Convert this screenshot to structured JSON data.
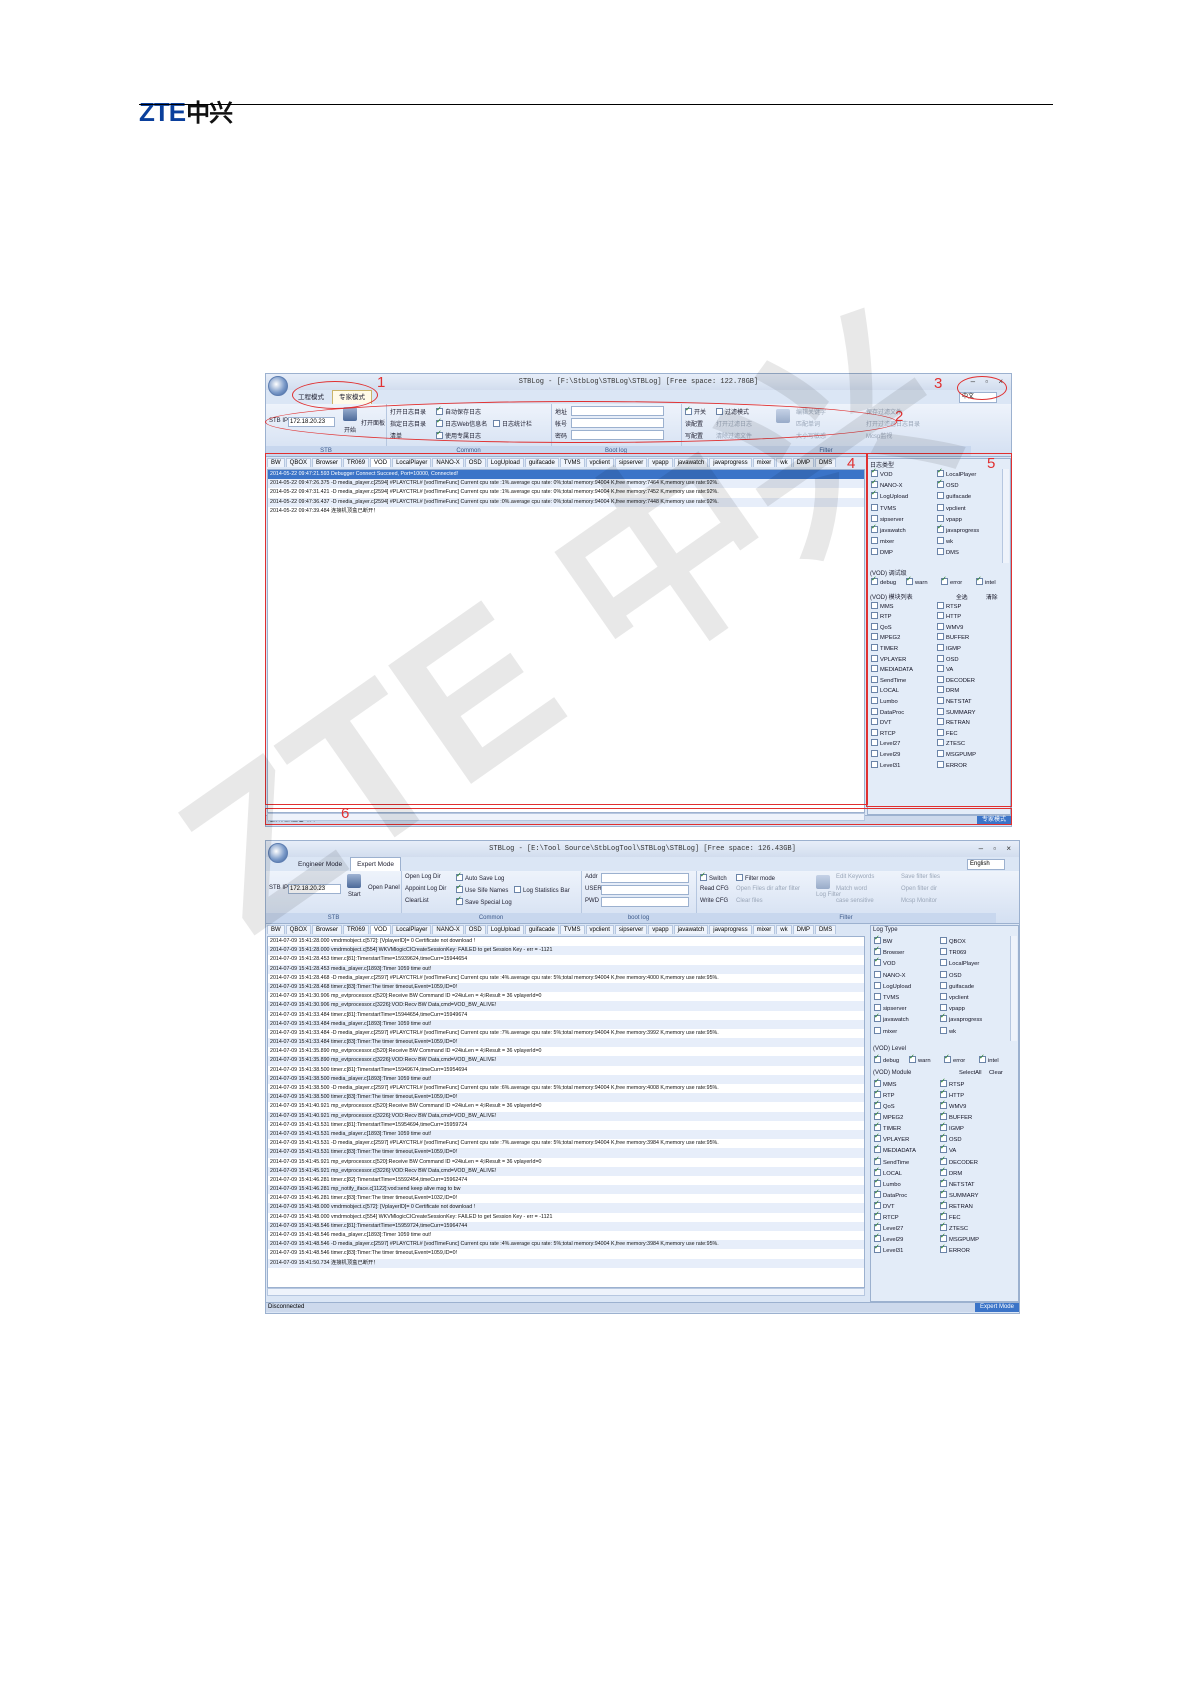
{
  "header": {
    "logo": "ZTE",
    "logo_cn": "中兴"
  },
  "watermark": "ZTE 中兴",
  "callouts": [
    "1",
    "2",
    "3",
    "4",
    "5",
    "6"
  ],
  "shot1": {
    "title": "STBLog - [F:\\StbLog\\STBLog\\STBLog] [Free space: 122.78GB]",
    "tabs": [
      "工程模式",
      "专家模式"
    ],
    "lang": "中文",
    "stb": {
      "label": "STB IP",
      "ip": "172.18.20.23",
      "start": "开始",
      "open_panel": "打开面板",
      "cap": "STB"
    },
    "common": {
      "items": [
        "打开日志目录",
        "指定日志目录",
        "清单",
        "自动保存日志",
        "日志Web信息名",
        "使用专属日志",
        "日志统计栏"
      ],
      "cap": "Common"
    },
    "bootlog": {
      "fields": [
        "地址",
        "帐号",
        "密码"
      ],
      "cap": "Boot log"
    },
    "filter": {
      "items": [
        "开关",
        "读配置",
        "写配置",
        "过滤模式",
        "打开过滤日志",
        "清除过滤文件",
        "编辑关键字",
        "匹配单词",
        "大小写敏感",
        "保存过滤文件",
        "打开过滤器日志目录",
        "Mcsp监视"
      ],
      "cap": "Filter"
    },
    "module_tabs": [
      "BW",
      "QBOX",
      "Browser",
      "TR069",
      "VOD",
      "LocalPlayer",
      "NANO-X",
      "OSD",
      "LogUpload",
      "guifacade",
      "TVMS",
      "vpclient",
      "sipserver",
      "vpapp",
      "javawatch",
      "javaprogress",
      "mixer",
      "wk",
      "DMP",
      "DMS"
    ],
    "logs": [
      "2014-05-22 09:47:21.593  Debugger Connect Succeed, Port=10000, Connected!",
      "2014-05-22 09:47:26.375  -D media_player.c[2594] #PLAYCTRL# [vodTimeFunc] Current cpu rate :1%.average cpu rate: 0%;total memory:94004 K,free memory:7464 K,memory use rate:92%.",
      "2014-05-22 09:47:31.421  -D media_player.c[2594] #PLAYCTRL# [vodTimeFunc] Current cpu rate :1%.average cpu rate: 0%;total memory:94004 K,free memory:7452 K,memory use rate:92%.",
      "2014-05-22 09:47:36.437  -D media_player.c[2594] #PLAYCTRL# [vodTimeFunc] Current cpu rate :0%.average cpu rate: 0%;total memory:94004 K,free memory:7448 K,memory use rate:92%.",
      "2014-05-22 09:47:39.484  连接机顶盒已断开！"
    ],
    "logtype_label": "日志类型",
    "logtypes": [
      "VOD",
      "LocalPlayer",
      "NANO-X",
      "OSD",
      "LogUpload",
      "guifacade",
      "TVMS",
      "vpclient",
      "sipserver",
      "vpapp",
      "javawatch",
      "javaprogress",
      "mixer",
      "wk",
      "DMP",
      "DMS"
    ],
    "logtypes_checked": [
      true,
      true,
      true,
      true,
      true,
      false,
      false,
      false,
      false,
      false,
      true,
      true,
      false,
      false,
      false,
      false
    ],
    "level_label": "(VOD) 调试级",
    "levels": [
      "debug",
      "warn",
      "error",
      "intel"
    ],
    "module_label": "(VOD) 模块列表",
    "select_all": "全选",
    "clear": "清除",
    "modules": [
      "MMS",
      "RTSP",
      "RTP",
      "HTTP",
      "QoS",
      "WMV9",
      "MPEG2",
      "BUFFER",
      "TIMER",
      "IGMP",
      "VPLAYER",
      "OSD",
      "MEDIADATA",
      "VA",
      "SendTime",
      "DECODER",
      "LOCAL",
      "DRM",
      "Lumbo",
      "NETSTAT",
      "DataProc",
      "SUMMARY",
      "DVT",
      "RETRAN",
      "RTCP",
      "FEC",
      "Level27",
      "ZTESC",
      "Level29",
      "MSGPUMP",
      "Level31",
      "ERROR"
    ],
    "status": "连接机顶盒已断开",
    "mode": "专家模式"
  },
  "shot2": {
    "title": "STBLog - [E:\\Tool Source\\StbLogTool\\STBLog\\STBLog] [Free space: 126.43GB]",
    "tabs": [
      "Engineer Mode",
      "Expert Mode"
    ],
    "lang": "English",
    "stb": {
      "label": "STB IP",
      "ip": "172.18.20.23",
      "start": "Start",
      "open_panel": "Open Panel",
      "cap": "STB"
    },
    "common": {
      "items": [
        "Open Log Dir",
        "Appoint Log Dir",
        "ClearList",
        "Auto Save Log",
        "Use Sife Names",
        "Save Special Log",
        "Log Statistics Bar"
      ],
      "cap": "Common"
    },
    "bootlog": {
      "fields": [
        "Addr",
        "USER",
        "PWD"
      ],
      "cap": "boot log"
    },
    "filter": {
      "items": [
        "Switch",
        "Read CFG",
        "Write CFG",
        "Filter mode",
        "Open Files dir after filter",
        "Clear files",
        "Log Filter",
        "Edit Keywords",
        "Match word",
        "case sensitive",
        "Save filter files",
        "Open filter dir",
        "Mcsp Monitor"
      ],
      "cap": "Filter"
    },
    "module_tabs": [
      "BW",
      "QBOX",
      "Browser",
      "TR069",
      "VOD",
      "LocalPlayer",
      "NANO-X",
      "OSD",
      "LogUpload",
      "guifacade",
      "TVMS",
      "vpclient",
      "sipserver",
      "vpapp",
      "javawatch",
      "javaprogress",
      "mixer",
      "wk",
      "DMP",
      "DMS"
    ],
    "logs": [
      "2014-07-09 15:41:28.000  vmdrmobject.c[572]: [VplayerID]= 0 Certificate not download !",
      "2014-07-09 15:41:28.000  vmdrmobject.c[554] WKVMlogicCICreateSessionKey: FAILED to get Session Key - err = -1121",
      "2014-07-09 15:41:28.453  timer.c[81]:TimerstartTime=15939624,timeCurr=15944654",
      "2014-07-09 15:41:28.453  media_player.c[1893]:Timer 1059  time out!",
      "2014-07-09 15:41:28.468  -D media_player.c[2597] #PLAYCTRL# [vodTimeFunc] Current cpu rate :4%.average cpu rate: 5%;total memory:94004 K,free memory:4000 K,memory use rate:95%.",
      "2014-07-09 15:41:28.468  timer.c[83]:Timer:The timer timeout,Event=1059,ID=0!",
      "2014-07-09 15:41:30.906  mp_evtprocessor.c[520]:Receive BW Command ID =24iuLen = 4;iResult = 36 vplayerId=0",
      "2014-07-09 15:41:30.906  mp_evtprocessor.c[3226]:VOD:Recv BW Data,cmd=VOD_BW_ALIVE!",
      "2014-07-09 15:41:33.484  timer.c[81]:TimerstartTime=15944654,timeCurr=15949674",
      "2014-07-09 15:41:33.484  media_player.c[1893]:Timer 1059  time out!",
      "2014-07-09 15:41:33.484  -D media_player.c[2597] #PLAYCTRL# [vodTimeFunc] Current cpu rate :7%.average cpu rate: 5%;total memory:94004 K,free memory:3992 K,memory use rate:95%.",
      "2014-07-09 15:41:33.484  timer.c[83]:Timer:The timer timeout,Event=1059,ID=0!",
      "2014-07-09 15:41:35.890  mp_evtprocessor.c[520]:Receive BW Command ID =24iuLen = 4;iResult = 36 vplayerId=0",
      "2014-07-09 15:41:35.890  mp_evtprocessor.c[3226]:VOD:Recv BW Data,cmd=VOD_BW_ALIVE!",
      "2014-07-09 15:41:38.500  timer.c[81]:TimerstartTime=15949674,timeCurr=15954694",
      "2014-07-09 15:41:38.500  media_player.c[1893]:Timer 1059  time out!",
      "2014-07-09 15:41:38.500  -D media_player.c[2597] #PLAYCTRL# [vodTimeFunc] Current cpu rate :6%.average cpu rate: 5%;total memory:94004 K,free memory:4008 K,memory use rate:95%.",
      "2014-07-09 15:41:38.500  timer.c[83]:Timer:The timer timeout,Event=1059,ID=0!",
      "2014-07-09 15:41:40.921  mp_evtprocessor.c[520]:Receive BW Command ID =24iuLen = 4;iResult = 36 vplayerId=0",
      "2014-07-09 15:41:40.921  mp_evtprocessor.c[3226]:VOD:Recv BW Data,cmd=VOD_BW_ALIVE!",
      "2014-07-09 15:41:43.531  timer.c[81]:TimerstartTime=15954694,timeCurr=15959724",
      "2014-07-09 15:41:43.531  media_player.c[1893]:Timer 1059  time out!",
      "2014-07-09 15:41:43.531  -D media_player.c[2597] #PLAYCTRL# [vodTimeFunc] Current cpu rate :7%.average cpu rate: 5%;total memory:94004 K,free memory:3984 K,memory use rate:95%.",
      "2014-07-09 15:41:43.531  timer.c[83]:Timer:The timer timeout,Event=1059,ID=0!",
      "2014-07-09 15:41:45.921  mp_evtprocessor.c[520]:Receive BW Command ID =24iuLen = 4;iResult = 36 vplayerId=0",
      "2014-07-09 15:41:45.921  mp_evtprocessor.c[3226]:VOD:Recv BW Data,cmd=VOD_BW_ALIVE!",
      "2014-07-09 15:41:46.281  timer.c[82]:TimerstartTime=15592454,timeCurr=15962474",
      "2014-07-09 15:41:46.281  mp_notify_iface.c[1122]:vod:send keep alive msg to bw",
      "2014-07-09 15:41:46.281  timer.c[83]:Timer:The timer timeout,Event=1032,ID=0!",
      "2014-07-09 15:41:48.000  vmdrmobject.c[572]: [VplayerID]= 0 Certificate not download !",
      "2014-07-09 15:41:48.000  vmdrmobject.c[554] WKVMlogicCICreateSessionKey: FAILED to get Session Key - err = -1121",
      "2014-07-09 15:41:48.546  timer.c[81]:TimerstartTime=15959724,timeCurr=15964744",
      "2014-07-09 15:41:48.546  media_player.c[1893]:Timer 1059  time out!",
      "2014-07-09 15:41:48.546  -D media_player.c[2597] #PLAYCTRL# [vodTimeFunc] Current cpu rate :4%.average cpu rate: 5%;total memory:94004 K,free memory:3984 K,memory use rate:95%.",
      "2014-07-09 15:41:48.546  timer.c[83]:Timer:The timer timeout,Event=1059,ID=0!",
      "2014-07-09 15:41:50.734  连接机顶盒已断开！"
    ],
    "logtype_label": "Log Type",
    "logtypes": [
      "BW",
      "QBOX",
      "Browser",
      "TR069",
      "VOD",
      "LocalPlayer",
      "NANO-X",
      "OSD",
      "LogUpload",
      "guifacade",
      "TVMS",
      "vpclient",
      "sipserver",
      "vpapp",
      "javawatch",
      "javaprogress",
      "mixer",
      "wk"
    ],
    "logtypes_checked": [
      true,
      false,
      true,
      false,
      true,
      false,
      false,
      false,
      false,
      false,
      false,
      false,
      false,
      false,
      true,
      true,
      false,
      false
    ],
    "level_label": "(VOD)  Level",
    "levels": [
      "debug",
      "warn",
      "error",
      "intel"
    ],
    "module_label": "(VOD)  Module",
    "select_all": "SelectAll",
    "clear": "Clear",
    "modules": [
      "MMS",
      "RTSP",
      "RTP",
      "HTTP",
      "QoS",
      "WMV9",
      "MPEG2",
      "BUFFER",
      "TIMER",
      "IGMP",
      "VPLAYER",
      "OSD",
      "MEDIADATA",
      "VA",
      "SendTime",
      "DECODER",
      "LOCAL",
      "DRM",
      "Lumbo",
      "NETSTAT",
      "DataProc",
      "SUMMARY",
      "DVT",
      "RETRAN",
      "RTCP",
      "FEC",
      "Level27",
      "ZTESC",
      "Level29",
      "MSGPUMP",
      "Level31",
      "ERROR"
    ],
    "status": "Disconnected",
    "mode": "Expert Mode"
  }
}
